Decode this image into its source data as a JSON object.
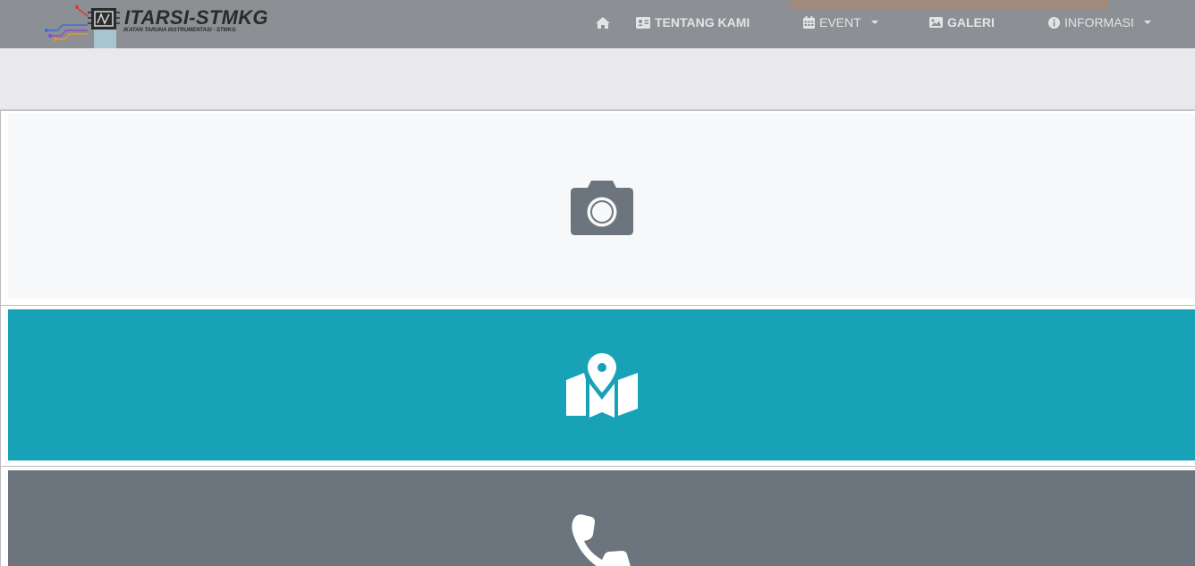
{
  "brand": {
    "title": "ITARSI-STMKG",
    "subtitle": "IKATAN TARUNA INSTRUMENTASI - STMKG"
  },
  "nav": {
    "items": [
      {
        "label": "",
        "icon": "home-icon"
      },
      {
        "label": "TENTANG KAMI",
        "icon": "id-card-icon"
      },
      {
        "label": "EVENT",
        "icon": "calendar-icon",
        "dropdown": true
      },
      {
        "label": "GALERI",
        "icon": "image-icon"
      },
      {
        "label": "INFORMASI",
        "icon": "info-circle-icon",
        "dropdown": true
      }
    ]
  },
  "cards": [
    {
      "icon": "camera-icon",
      "color": "#f7f8fa",
      "icon_color": "#6c757d"
    },
    {
      "icon": "map-marked-icon",
      "color": "#17a2b8",
      "icon_color": "#ffffff"
    },
    {
      "icon": "phone-icon",
      "color": "#6c757d",
      "icon_color": "#ffffff"
    }
  ],
  "colors": {
    "navbar": "#8c8f93",
    "band": "#e9e8ea",
    "info": "#17a2b8",
    "secondary": "#6c757d"
  }
}
